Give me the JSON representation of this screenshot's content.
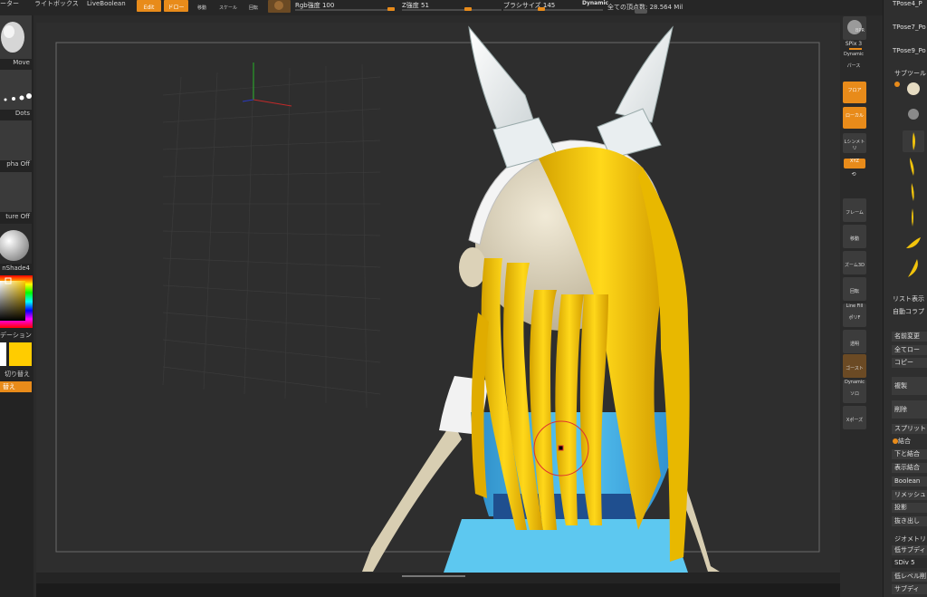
{
  "topbar": {
    "left_label1": "ーター",
    "left_label2": "ライトボックス",
    "left_label3": "LiveBoolean",
    "edit_btn": "Edit",
    "draw_btn": "ドロー",
    "move_tool": "移動",
    "scale_tool": "スケール",
    "rotate_tool": "回転",
    "rgb_label": "Rgb強度 100",
    "z_label": "Z強度 51",
    "brush_label": "ブラシサイズ 145",
    "dynamic_label": "Dynamic",
    "vertex_count": "全ての頂点数: 28.564 Mil",
    "rgb_value": 100,
    "z_value": 51,
    "brush_value": 145
  },
  "left_shelf": {
    "brush_name": "Move",
    "stroke_name": "Dots",
    "alpha_name": "pha Off",
    "texture_name": "ture Off",
    "material_name": "nShade4",
    "gradient_label": "デーション",
    "switch_label": "切り替え",
    "swap_label": "替え"
  },
  "right_shelf": {
    "bpr_label": "BPR",
    "spix_label": "SPix 3",
    "dynamic_label": "Dynamic",
    "perspective_label": "パース",
    "floor_label": "フロア",
    "local_label": "ローカル",
    "lsym_label": "Lシンメトリ",
    "xyz_label": "XYZ",
    "frame_label": "フレーム",
    "move_label": "移動",
    "zoom_label": "ズーム3D",
    "rotate_label": "回転",
    "linefill_label": "Line Fill",
    "polyf_label": "ポリF",
    "transp_label": "透明",
    "ghost_label": "ゴースト",
    "solo_label": "ソロ",
    "xpose_label": "Xポーズ",
    "dynamic2_label": "Dynamic"
  },
  "subtool_panel": {
    "tpose_items": [
      "TPose4_P",
      "TPose7_Po",
      "TPose9_Po"
    ],
    "header": "サブツール",
    "list_all": "リスト表示",
    "auto_collapse": "自動コラプ",
    "rename": "名前変更",
    "all_low": "全てロー",
    "copy": "コピー",
    "duplicate": "複製",
    "delete": "削除",
    "split": "スプリット",
    "merge": "結合",
    "merge_down": "下と結合",
    "merge_visible": "表示結合",
    "boolean": "Boolean",
    "remesh": "リメッシュ",
    "project": "投影",
    "extract": "抜き出し",
    "geometry_header": "ジオメトリ",
    "lower_subdiv": "低サブディ",
    "sdiv": "SDiv 5",
    "del_lower": "低レベル削",
    "subdiv_btn": "サブディ"
  },
  "colors": {
    "accent": "#e88b1a",
    "hair": "#f2c40c",
    "skin": "#e6dcc2",
    "outfit": "#4bb5e6"
  }
}
